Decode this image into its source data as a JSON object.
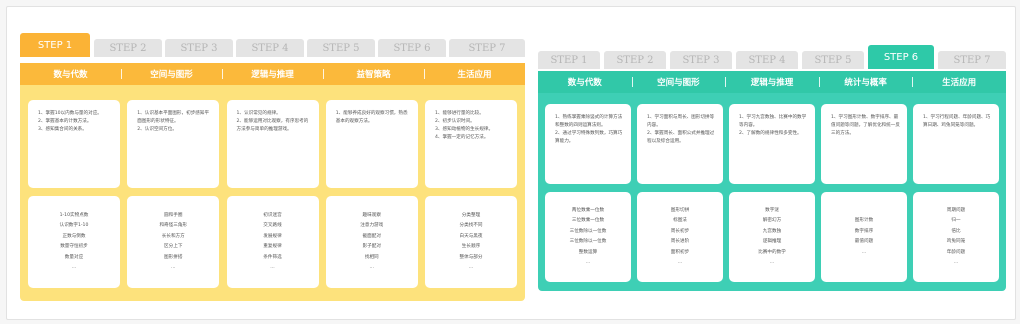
{
  "left": {
    "tabs": [
      "STEP 1",
      "STEP 2",
      "STEP 3",
      "STEP 4",
      "STEP 5",
      "STEP 6",
      "STEP 7"
    ],
    "categories": [
      "数与代数",
      "空间与图形",
      "逻辑与推理",
      "益智策略",
      "生活应用"
    ],
    "goals": [
      [
        "1、掌握10以内数与量的对应。",
        "2、掌握基本的计数方法。",
        "3、感知集合间的关系。"
      ],
      [
        "1、认识基本平面图形，初步感知平面图形的形状特征。",
        "2、认识空间方位。"
      ],
      [
        "1、认识常见的规律。",
        "2、能够运用对比观察，有序思考的方法参与简单的推理游戏。"
      ],
      [
        "1、能够养成良好的观察习惯，熟悉基本的观察方法。"
      ],
      [
        "1、能够进行量的比较。",
        "2、初步认识时间。",
        "3、感知动植物的生长规律。",
        "4、掌握一定的记忆方法。"
      ]
    ],
    "topics": [
      [
        "1-10实物点数",
        "认识数字1-10",
        "正数与倒数",
        "数量守恒初步",
        "数量对应",
        "..."
      ],
      [
        "圆和手圈",
        "和奇怪三角形",
        "长长和方方",
        "区分上下",
        "图形拼搭",
        "..."
      ],
      [
        "初识迷宫",
        "交叉路线",
        "发展规律",
        "重复规律",
        "条件筛选",
        "..."
      ],
      [
        "趣味观察",
        "注意力游戏",
        "截面配对",
        "影子配对",
        "找相同",
        "..."
      ],
      [
        "分类整理",
        "分类找不同",
        "白天与黑夜",
        "生长顺序",
        "整体与部分",
        "..."
      ]
    ]
  },
  "right": {
    "tabs": [
      "STEP 1",
      "STEP 2",
      "STEP 3",
      "STEP 4",
      "STEP 5",
      "STEP 6",
      "STEP 7"
    ],
    "categories": [
      "数与代数",
      "空间与图形",
      "逻辑与推理",
      "统计与概率",
      "生活应用"
    ],
    "goals": [
      [
        "1、熟练掌握乘除竖式的计算方法和整数的四则运算法则。",
        "2、通过学习特殊数列数，巧算巧算能力。"
      ],
      [
        "1、学习面积与周长、图形切拼等内容。",
        "2、掌握周长、面积公式并推理过程以及综合运用。"
      ],
      [
        "1、学习九宫数独、比赛中的数学等内容。",
        "2、了解数的规律性和多变性。"
      ],
      [
        "1、学习图形计数、数字排序、最值问题等问题，了解优化和统一反三的方法。"
      ],
      [
        "1、学习行程问题、年龄问题、巧算日期、鸡兔同笼等问题。"
      ]
    ],
    "topics": [
      [
        "两位数乘一位数",
        "三位数乘一位数",
        "三位数除以一位数",
        "三位数除以一位数",
        "整数运算",
        "..."
      ],
      [
        "图形切拼",
        "标图法",
        "周长初步",
        "周长进阶",
        "面积初步",
        "..."
      ],
      [
        "数字谜",
        "解密幻方",
        "九宫数独",
        "逻辑推理",
        "比赛中的数学",
        "..."
      ],
      [
        "图形计数",
        "数字排序",
        "最值问题",
        "..."
      ],
      [
        "周期问题",
        "归一",
        "倍比",
        "鸡兔同笼",
        "年龄问题",
        "..."
      ]
    ]
  },
  "colors": {
    "left_tab_active": "#fbb336",
    "left_header": "#fbb93b",
    "left_body": "#fde27c",
    "right_tab_active": "#2ec9a8",
    "right_header": "#31c8a8",
    "right_body": "#3ecfb5",
    "inactive_tab": "#e4e4e4"
  }
}
